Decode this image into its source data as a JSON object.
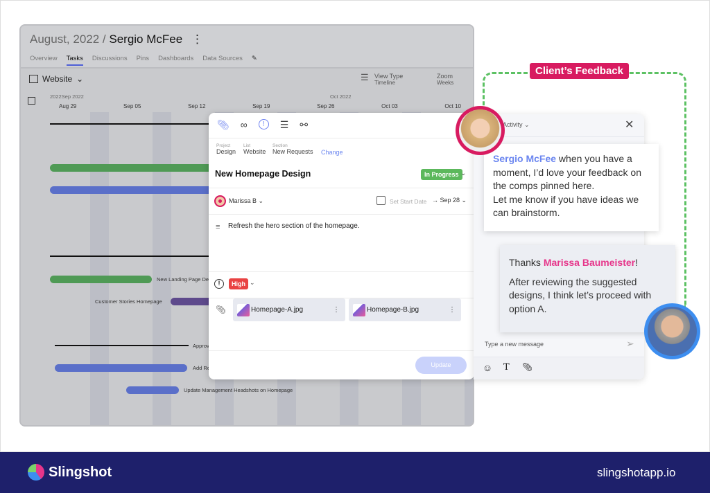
{
  "gantt": {
    "title_prefix": "August, 2022 /",
    "title_name": "Sergio McFee",
    "tabs": [
      "Overview",
      "Tasks",
      "Discussions",
      "Pins",
      "Dashboards",
      "Data Sources"
    ],
    "active_tab": "Tasks",
    "list": "Website",
    "view_type_label": "View Type",
    "view_type_value": "Timeline",
    "zoom_label": "Zoom",
    "zoom_value": "Weeks",
    "year_label": "2022",
    "month1": "Sep 2022",
    "month2": "Oct 2022",
    "weeks": [
      "Aug 29",
      "Sep 05",
      "Sep 12",
      "Sep 19",
      "Sep 26",
      "Oct 03",
      "Oct 10"
    ],
    "tasks": [
      "New Landing Page De",
      "Customer Stories Homepage",
      "Approv",
      "Add Re",
      "Update Management Headshots on Homepage"
    ]
  },
  "task": {
    "crumb_labels": [
      "Project",
      "List",
      "Section"
    ],
    "crumbs": [
      "Design",
      "Website",
      "New Requests"
    ],
    "change": "Change",
    "title": "New Homepage Design",
    "status": "In Progress",
    "status_color": "#5cb85c",
    "assignee": "Marissa B",
    "start_date": "Set Start Date",
    "due_date": "Sep 28",
    "description": "Refresh the hero section of the homepage.",
    "priority": "High",
    "priority_color": "#e94343",
    "attachments": [
      "Homepage-A.jpg",
      "Homepage-B.jpg"
    ],
    "update": "Update"
  },
  "chat": {
    "header": "Activity",
    "msg1_name": "Sergio McFee",
    "msg1_text": " when you have a moment, I’d love your feedback on the comps pinned here.",
    "msg1_text2": "Let me know if you have ideas we can brainstorm.",
    "msg2_prefix": "Thanks ",
    "msg2_name": "Marissa Baumeister",
    "msg2_suffix": "!",
    "msg2_text": "After reviewing the suggested designs, I think let’s proceed with option A.",
    "placeholder": "Type a new message"
  },
  "callout": {
    "label": "Client’s Feedback",
    "color": "#d81b60"
  },
  "footer": {
    "brand": "Slingshot",
    "url": "slingshotapp.io",
    "bg": "#1e206b"
  }
}
